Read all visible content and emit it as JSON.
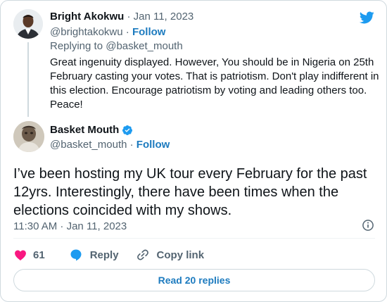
{
  "reply": {
    "name": "Bright Akokwu",
    "separator": "·",
    "date": "Jan 11, 2023",
    "handle": "@brightakokwu",
    "follow": "Follow",
    "replying_prefix": "Replying to ",
    "replying_to": "@basket_mouth",
    "text": "Great ingenuity displayed. However, You should be in Nigeria on 25th February casting your votes. That is patriotism. Don't play indifferent in this election. Encourage patriotism by voting and leading others too. Peace!"
  },
  "tweet": {
    "name": "Basket Mouth",
    "handle": "@basket_mouth",
    "separator": "·",
    "follow": "Follow",
    "text": "I’ve been hosting my UK tour every February for the past 12yrs. Interestingly, there have been times when the elections coincided with my shows.",
    "time": "11:30 AM · Jan 11, 2023",
    "likes": "61",
    "reply_label": "Reply",
    "copy_link_label": "Copy link",
    "read_replies_label": "Read 20 replies"
  },
  "icons": {
    "logo": "twitter-bird-icon",
    "verified": "verified-badge-icon",
    "info": "info-icon",
    "like": "heart-icon",
    "reply": "speech-bubble-icon",
    "copy": "link-icon"
  },
  "colors": {
    "brand_blue": "#1d9bf0",
    "link_blue": "#1d7bbf",
    "like_red": "#f91880",
    "muted_text": "#536471",
    "border": "#cfd9de"
  }
}
